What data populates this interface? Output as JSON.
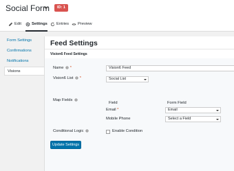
{
  "header": {
    "form_title": "Social Form",
    "id_badge": "ID: 1"
  },
  "toolbar": {
    "tabs": [
      {
        "label": "Edit",
        "icon": "pencil-icon"
      },
      {
        "label": "Settings",
        "icon": "gear-icon",
        "active": true
      },
      {
        "label": "Entries",
        "icon": "refresh-icon"
      },
      {
        "label": "Preview",
        "icon": "eye-icon"
      }
    ]
  },
  "sidebar": {
    "items": [
      {
        "label": "Form Settings"
      },
      {
        "label": "Confirmations"
      },
      {
        "label": "Notifications"
      },
      {
        "label": "Visions",
        "active": true
      }
    ]
  },
  "main": {
    "title": "Feed Settings",
    "section_title": "Vision6 Feed Settings",
    "fields": {
      "name_label": "Name",
      "name_value": "Vision6 Feed",
      "list_label": "Vision6 List",
      "list_value": "Social List",
      "map_fields_label": "Map Fields",
      "col_field": "Field",
      "col_form_field": "Form Field",
      "email_label": "Email",
      "email_value": "Email",
      "mobile_label": "Mobile Phone",
      "mobile_value": "Select a Field",
      "conditional_label": "Conditional Logic",
      "enable_condition": "Enable Condition"
    },
    "update_button": "Update Settings"
  },
  "colors": {
    "accent": "#0073aa",
    "badge": "#d9534f",
    "required": "#d54e21"
  }
}
